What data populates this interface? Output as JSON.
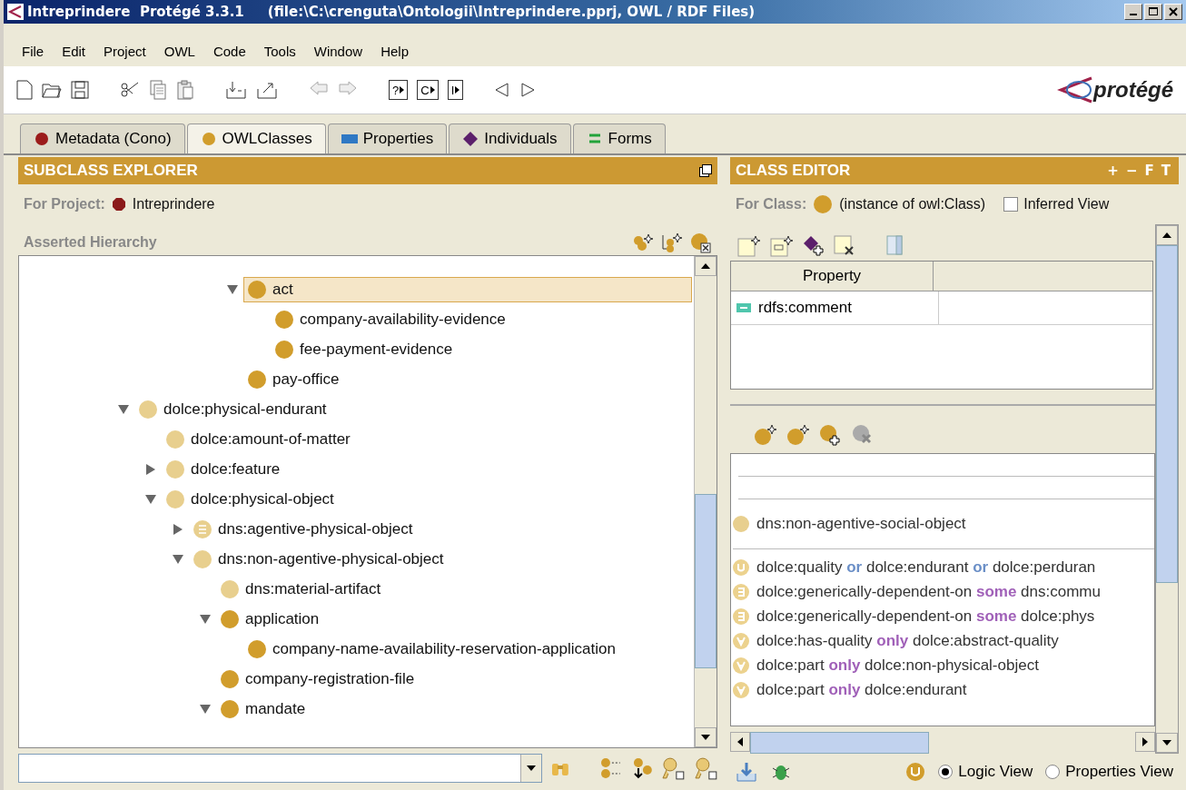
{
  "window": {
    "title": "Intreprindere  Protégé 3.3.1     (file:\\C:\\crenguta\\Ontologii\\Intreprindere.pprj, OWL / RDF Files)"
  },
  "menu": [
    "File",
    "Edit",
    "Project",
    "OWL",
    "Code",
    "Tools",
    "Window",
    "Help"
  ],
  "toolbar": {
    "letter_buttons": [
      "?",
      "C",
      "I"
    ]
  },
  "logo": {
    "text": "protégé"
  },
  "tabs": [
    {
      "label": "Metadata (Cono)",
      "kind": "metadata",
      "selected": false
    },
    {
      "label": "OWLClasses",
      "kind": "classes",
      "selected": true
    },
    {
      "label": "Properties",
      "kind": "properties",
      "selected": false
    },
    {
      "label": "Individuals",
      "kind": "individuals",
      "selected": false
    },
    {
      "label": "Forms",
      "kind": "forms",
      "selected": false
    }
  ],
  "subclass_explorer": {
    "title": "SUBCLASS EXPLORER",
    "project_label": "For Project:",
    "project_name": "Intreprindere",
    "hierarchy_label": "Asserted Hierarchy",
    "tree": [
      {
        "children": [
          {
            "children": [
              {
                "children": [
                  {
                    "children": [
                      {
                        "label": "act",
                        "color": "#d19d2c",
                        "selected": true,
                        "expanded": true,
                        "children": [
                          {
                            "label": "company-availability-evidence",
                            "color": "#d19d2c",
                            "selected": false
                          },
                          {
                            "label": "fee-payment-evidence",
                            "color": "#d19d2c",
                            "selected": false
                          }
                        ]
                      },
                      {
                        "label": "pay-office",
                        "color": "#d19d2c",
                        "selected": false
                      }
                    ]
                  }
                ]
              }
            ]
          }
        ]
      },
      {
        "label": "dolce:physical-endurant",
        "color": "#e8cf8e",
        "selected": false,
        "expanded": true,
        "children": [
          {
            "label": "dolce:amount-of-matter",
            "color": "#e8cf8e",
            "selected": false
          },
          {
            "label": "dolce:feature",
            "color": "#e8cf8e",
            "selected": false,
            "expanded": false
          },
          {
            "label": "dolce:physical-object",
            "color": "#e8cf8e",
            "selected": false,
            "expanded": true,
            "children": [
              {
                "label": "dns:agentive-physical-object",
                "color": "#e8cf8e",
                "kind": "defined",
                "selected": false,
                "expanded": false
              },
              {
                "label": "dns:non-agentive-physical-object",
                "color": "#e8cf8e",
                "selected": false,
                "expanded": true,
                "children": [
                  {
                    "label": "dns:material-artifact",
                    "color": "#e8cf8e",
                    "selected": false
                  },
                  {
                    "label": "application",
                    "color": "#d19d2c",
                    "selected": false,
                    "expanded": true,
                    "children": [
                      {
                        "label": "company-name-availability-reservation-application",
                        "color": "#d19d2c",
                        "selected": false
                      }
                    ]
                  },
                  {
                    "label": "company-registration-file",
                    "color": "#d19d2c",
                    "selected": false
                  },
                  {
                    "label": "mandate",
                    "color": "#d19d2c",
                    "selected": false,
                    "expanded": true
                  }
                ]
              }
            ]
          }
        ]
      }
    ]
  },
  "class_editor": {
    "title": "CLASS EDITOR",
    "header_buttons": [
      "+",
      "−",
      "F",
      "T"
    ],
    "class_label": "For Class:",
    "class_type": "(instance of owl:Class)",
    "inferred_view": {
      "label": "Inferred View",
      "checked": false
    },
    "table": {
      "columns": [
        "Property"
      ],
      "rows": [
        {
          "property": "rdfs:comment"
        }
      ]
    },
    "conditions": [
      {
        "kind": "superclass",
        "parts": [
          {
            "text": "dns:non-agentive-social-object"
          }
        ]
      },
      {
        "kind": "union",
        "parts": [
          {
            "text": "dolce:quality "
          },
          {
            "text": "or",
            "kind": "operator"
          },
          {
            "text": " dolce:endurant "
          },
          {
            "text": "or",
            "kind": "operator"
          },
          {
            "text": " dolce:perduran"
          }
        ]
      },
      {
        "kind": "some",
        "parts": [
          {
            "text": "dolce:generically-dependent-on "
          },
          {
            "text": "some",
            "kind": "restriction"
          },
          {
            "text": " dns:commu"
          }
        ]
      },
      {
        "kind": "some",
        "parts": [
          {
            "text": "dolce:generically-dependent-on "
          },
          {
            "text": "some",
            "kind": "restriction"
          },
          {
            "text": " dolce:phys"
          }
        ]
      },
      {
        "kind": "only",
        "parts": [
          {
            "text": "dolce:has-quality "
          },
          {
            "text": "only",
            "kind": "restriction"
          },
          {
            "text": " dolce:abstract-quality"
          }
        ]
      },
      {
        "kind": "only",
        "parts": [
          {
            "text": "dolce:part "
          },
          {
            "text": "only",
            "kind": "restriction"
          },
          {
            "text": " dolce:non-physical-object"
          }
        ]
      },
      {
        "kind": "only",
        "parts": [
          {
            "text": "dolce:part "
          },
          {
            "text": "only",
            "kind": "restriction"
          },
          {
            "text": " dolce:endurant"
          }
        ]
      }
    ],
    "views": [
      {
        "label": "Logic View",
        "selected": true
      },
      {
        "label": "Properties View",
        "selected": false
      }
    ]
  }
}
